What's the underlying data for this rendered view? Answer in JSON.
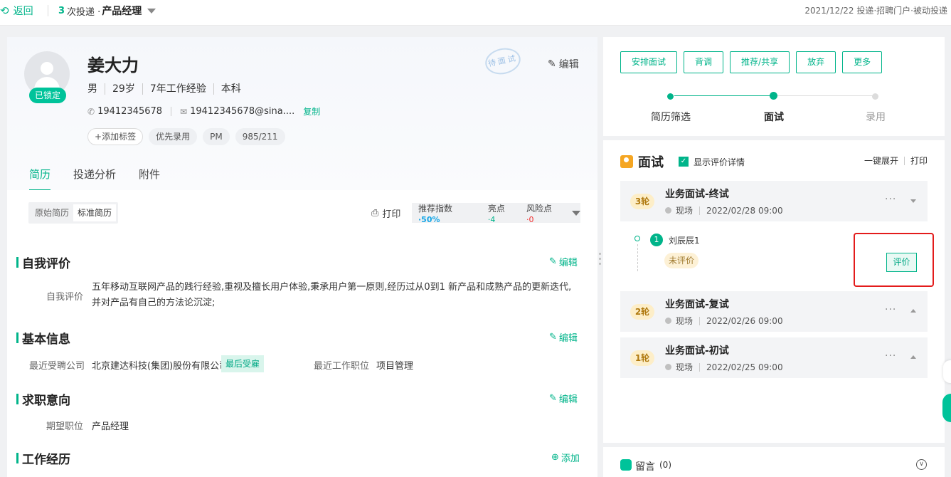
{
  "topbar": {
    "back_label": "返回",
    "apply_count": "3",
    "apply_text": "次投递 ·",
    "position": "产品经理",
    "right_info": "2021/12/22 投递·招聘门户·被动投递"
  },
  "candidate": {
    "status": "已锁定",
    "name": "姜大力",
    "meta": [
      "男",
      "29岁",
      "7年工作经验",
      "本科"
    ],
    "phone": "19412345678",
    "email": "19412345678@sina....",
    "copy_label": "复制",
    "add_tag_label": "添加标签",
    "tags": [
      "优先录用",
      "PM",
      "985/211"
    ],
    "stamp": "待面试",
    "edit_label": "编辑"
  },
  "tabs": [
    "简历",
    "投递分析",
    "附件"
  ],
  "resume_toolbar": {
    "views": [
      "原始简历",
      "标准简历"
    ],
    "print_label": "打印",
    "recommend_label": "推荐指数",
    "recommend_value": "·50%",
    "highlight_label": "亮点",
    "highlight_value": "·4",
    "risk_label": "风险点",
    "risk_value": "·0"
  },
  "sections": {
    "self_eval": {
      "title": "自我评价",
      "edit": "编辑",
      "label": "自我评价",
      "text": "五年移动互联网产品的践行经验,重视及擅长用户体验,秉承用户第一原则,经历过从0到1  新产品和成熟产品的更新迭代,并对产品有自己的方法论沉淀;"
    },
    "basic": {
      "title": "基本信息",
      "edit": "编辑",
      "company_label": "最近受聘公司",
      "company": "北京建达科技(集团)股份有限公司",
      "company_badge": "最后受雇",
      "role_label": "最近工作职位",
      "role": "项目管理"
    },
    "intent": {
      "title": "求职意向",
      "edit": "编辑",
      "position_label": "期望职位",
      "position": "产品经理"
    },
    "work": {
      "title": "工作经历",
      "add": "添加"
    }
  },
  "actions": [
    "安排面试",
    "背调",
    "推荐/共享",
    "放弃",
    "更多"
  ],
  "steps": [
    {
      "label": "简历筛选",
      "state": "done"
    },
    {
      "label": "面试",
      "state": "current"
    },
    {
      "label": "录用",
      "state": "todo"
    }
  ],
  "interview": {
    "title": "面试",
    "show_detail_label": "显示评价详情",
    "expand_all": "一键展开",
    "print": "打印",
    "rounds": [
      {
        "round": "3轮",
        "name": "业务面试-终试",
        "location": "现场",
        "time": "2022/02/28 09:00",
        "expanded": true
      },
      {
        "round": "2轮",
        "name": "业务面试-复试",
        "location": "现场",
        "time": "2022/02/26 09:00",
        "expanded": false
      },
      {
        "round": "1轮",
        "name": "业务面试-初试",
        "location": "现场",
        "time": "2022/02/25 09:00",
        "expanded": false
      }
    ],
    "interviewer": {
      "index": "1",
      "name": "刘辰辰1",
      "status": "未评价",
      "eval_button": "评价"
    }
  },
  "message": {
    "label": "留言",
    "count": "(0)"
  },
  "colors": {
    "accent": "#00b48a",
    "highlight_border": "#e31b1b"
  }
}
